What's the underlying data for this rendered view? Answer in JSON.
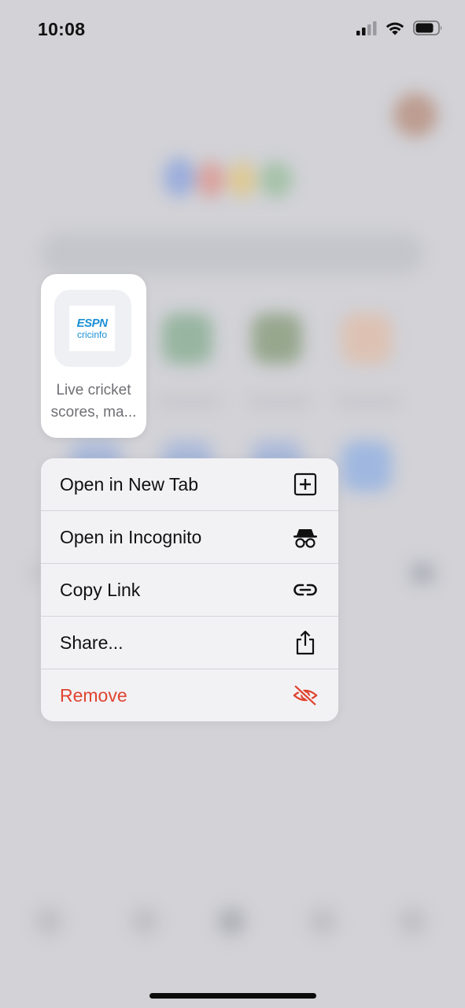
{
  "status_bar": {
    "time": "10:08"
  },
  "preview": {
    "logo_line1": "ESPN",
    "logo_line2": "cricinfo",
    "title_line1": "Live cricket",
    "title_line2": "scores, ma..."
  },
  "menu": {
    "items": [
      {
        "label": "Open in New Tab",
        "icon": "plus-square-icon"
      },
      {
        "label": "Open in Incognito",
        "icon": "incognito-icon"
      },
      {
        "label": "Copy Link",
        "icon": "link-icon"
      },
      {
        "label": "Share...",
        "icon": "share-icon"
      },
      {
        "label": "Remove",
        "icon": "eye-slash-icon"
      }
    ]
  },
  "colors": {
    "danger": "#e0442f",
    "logo_blue": "#1a8fd6",
    "menu_bg": "#f2f2f5",
    "backdrop": "#d2d2d7"
  }
}
